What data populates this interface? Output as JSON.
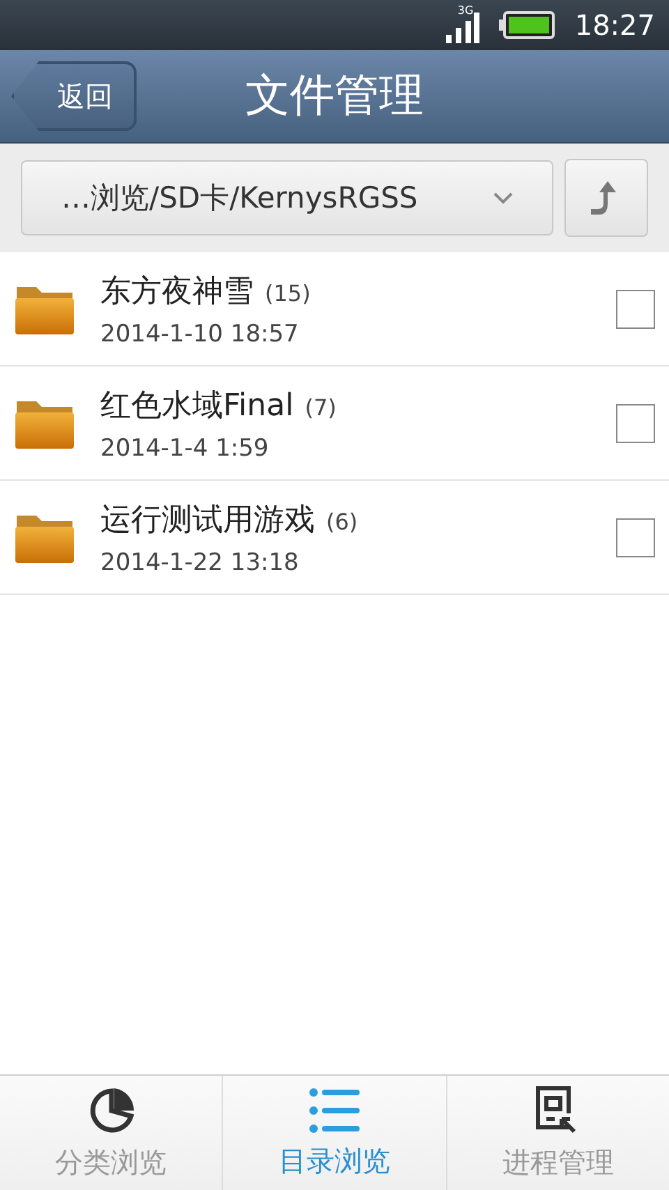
{
  "status_bar": {
    "network": "3G",
    "time": "18:27"
  },
  "header": {
    "back": "返回",
    "title": "文件管理"
  },
  "path_bar": {
    "path": "…浏览/SD卡/KernysRGSS"
  },
  "files": [
    {
      "name": "东方夜神雪",
      "count": "(15)",
      "date": "2014-1-10 18:57",
      "checked": false
    },
    {
      "name": "红色水域Final",
      "count": "(7)",
      "date": "2014-1-4 1:59",
      "checked": false
    },
    {
      "name": "运行测试用游戏",
      "count": "(6)",
      "date": "2014-1-22 13:18",
      "checked": false
    }
  ],
  "tabs": [
    {
      "kind": "category",
      "label": "分类浏览",
      "selected": false
    },
    {
      "kind": "directory",
      "label": "目录浏览",
      "selected": true
    },
    {
      "kind": "process",
      "label": "进程管理",
      "selected": false
    }
  ]
}
